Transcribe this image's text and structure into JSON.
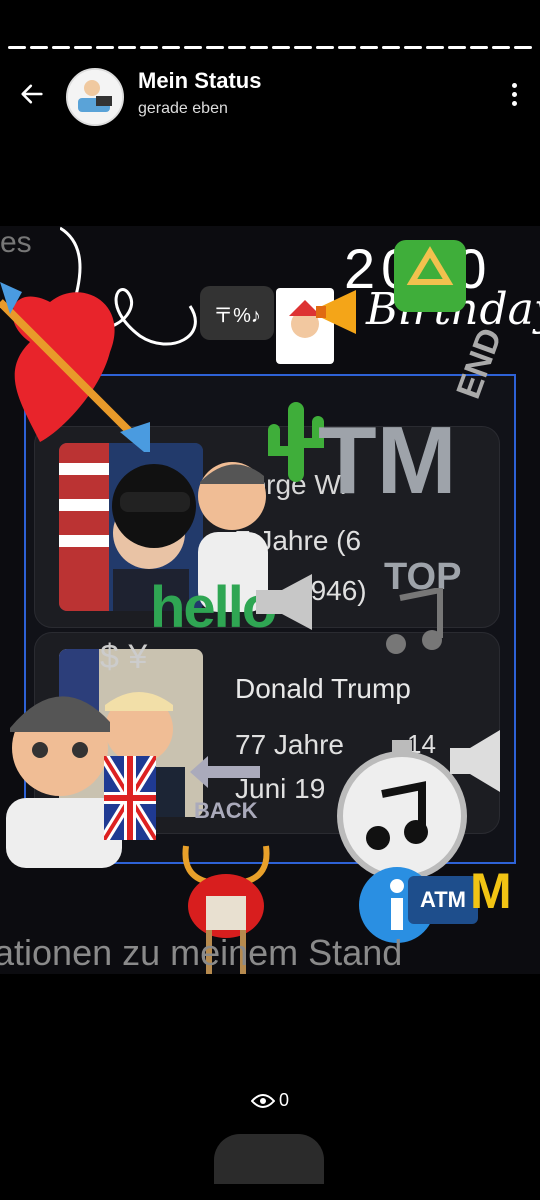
{
  "header": {
    "title": "Mein Status",
    "subtitle": "gerade eben",
    "back_icon": "arrow-left-icon",
    "menu_icon": "more-vertical-icon"
  },
  "status": {
    "card": {
      "row1": {
        "name": "eorge W.",
        "age": "7 Jahre (6",
        "date": "1946)"
      },
      "row2": {
        "name": "Donald Trump",
        "age": "77 Jahre",
        "date_day": "14",
        "date": "Juni 19"
      }
    },
    "overlays": {
      "corner_text": "es",
      "year_text": "2000",
      "script_text": "Birthday",
      "emoji_symbols": "〒%♪",
      "tm_text": "TM",
      "end_text": "END",
      "top_text": "TOP",
      "hello_text": "hello",
      "back_text": "BACK",
      "atm_text": "ATM",
      "money_symbols": "$ ¥",
      "bottom_caption": "ationen zu meinem Stand"
    }
  },
  "footer": {
    "views_count": "0",
    "views_icon": "eye-icon"
  },
  "colors": {
    "background": "#000000",
    "card_border": "#2e62d6"
  }
}
